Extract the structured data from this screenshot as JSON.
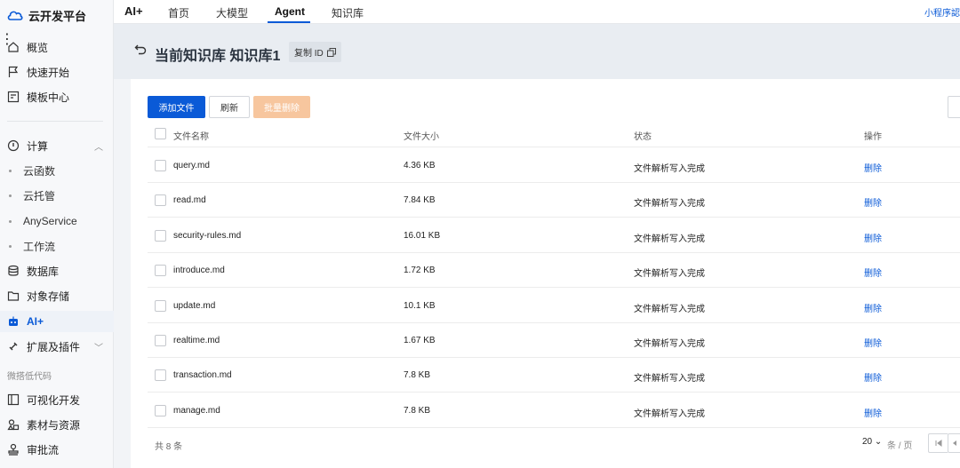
{
  "sidebar": {
    "brand": "云开发平台",
    "items": {
      "overview": "概览",
      "quickstart": "快速开始",
      "templates": "模板中心",
      "compute": "计算",
      "cloud_function": "云函数",
      "cloud_run": "云托管",
      "any_service": "AnyService",
      "workflow": "工作流",
      "database": "数据库",
      "storage": "对象存储",
      "ai": "AI+",
      "extensions": "扩展及插件",
      "visual_dev": "可视化开发",
      "assets": "素材与资源",
      "approval": "审批流"
    },
    "section_lowcode": "微搭低代码"
  },
  "topbar": {
    "title": "AI+",
    "tabs": [
      "首页",
      "大模型",
      "Agent",
      "知识库"
    ],
    "active_tab": "Agent",
    "right_link": "小程序認"
  },
  "header": {
    "title": "当前知识库 知识库1",
    "copy_id": "复制 ID"
  },
  "toolbar": {
    "add": "添加文件",
    "refresh": "刷新",
    "batch_delete": "批量删除"
  },
  "table": {
    "columns": [
      "文件名称",
      "文件大小",
      "状态",
      "操作"
    ],
    "rows": [
      {
        "name": "query.md",
        "size": "4.36 KB",
        "status": "文件解析写入完成",
        "action": "删除"
      },
      {
        "name": "read.md",
        "size": "7.84 KB",
        "status": "文件解析写入完成",
        "action": "删除"
      },
      {
        "name": "security-rules.md",
        "size": "16.01 KB",
        "status": "文件解析写入完成",
        "action": "删除"
      },
      {
        "name": "introduce.md",
        "size": "1.72 KB",
        "status": "文件解析写入完成",
        "action": "删除"
      },
      {
        "name": "update.md",
        "size": "10.1 KB",
        "status": "文件解析写入完成",
        "action": "删除"
      },
      {
        "name": "realtime.md",
        "size": "1.67 KB",
        "status": "文件解析写入完成",
        "action": "删除"
      },
      {
        "name": "transaction.md",
        "size": "7.8 KB",
        "status": "文件解析写入完成",
        "action": "删除"
      },
      {
        "name": "manage.md",
        "size": "7.8 KB",
        "status": "文件解析写入完成",
        "action": "删除"
      }
    ]
  },
  "footer": {
    "total": "共 8 条",
    "page_size": "20",
    "page_unit": "条 / 页"
  },
  "colors": {
    "primary": "#0a5ad7",
    "disabled_orange": "#f7c69e"
  }
}
